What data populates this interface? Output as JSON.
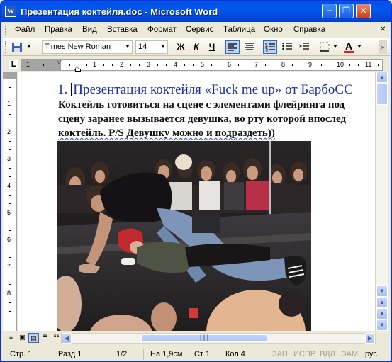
{
  "window": {
    "title": "Презентация коктейля.doc - Microsoft Word",
    "app_icon": "W"
  },
  "menu": [
    "Файл",
    "Правка",
    "Вид",
    "Вставка",
    "Формат",
    "Сервис",
    "Таблица",
    "Окно",
    "Справка"
  ],
  "toolbar": {
    "font_name": "Times New Roman",
    "font_size": "14",
    "bold": "Ж",
    "italic": "К",
    "underline": "Ч",
    "font_color_label": "A",
    "font_color": "#e02020"
  },
  "ruler": {
    "tab_selector": "L",
    "numbers": [
      "1",
      "1",
      "2",
      "3",
      "4",
      "5",
      "6",
      "7",
      "8",
      "9",
      "10",
      "11"
    ]
  },
  "vruler": {
    "numbers": [
      "1",
      "2",
      "3",
      "4",
      "5",
      "6",
      "7",
      "8"
    ]
  },
  "document": {
    "heading_number": "1.",
    "heading_text": "Презентация коктейля «Fuck me up» от БарбоСС",
    "heading_color": "#1a2fb5",
    "lines": [
      " Коктейль готовиться на сцене с элементами флейринга под",
      "сцену заранее вызывается девушка, во рту которой впослед",
      "коктейль. P/S Девушку можно и подраздеть))"
    ]
  },
  "status": {
    "page": "Стр.  1",
    "section": "Разд  1",
    "pages": "1/2",
    "position": "На  1,9см",
    "line": "Ст  1",
    "column": "Кол  4",
    "rec": "ЗАП",
    "trk": "ИСПР",
    "ext": "ВДЛ",
    "ovr": "ЗАМ",
    "lang": "рус"
  }
}
